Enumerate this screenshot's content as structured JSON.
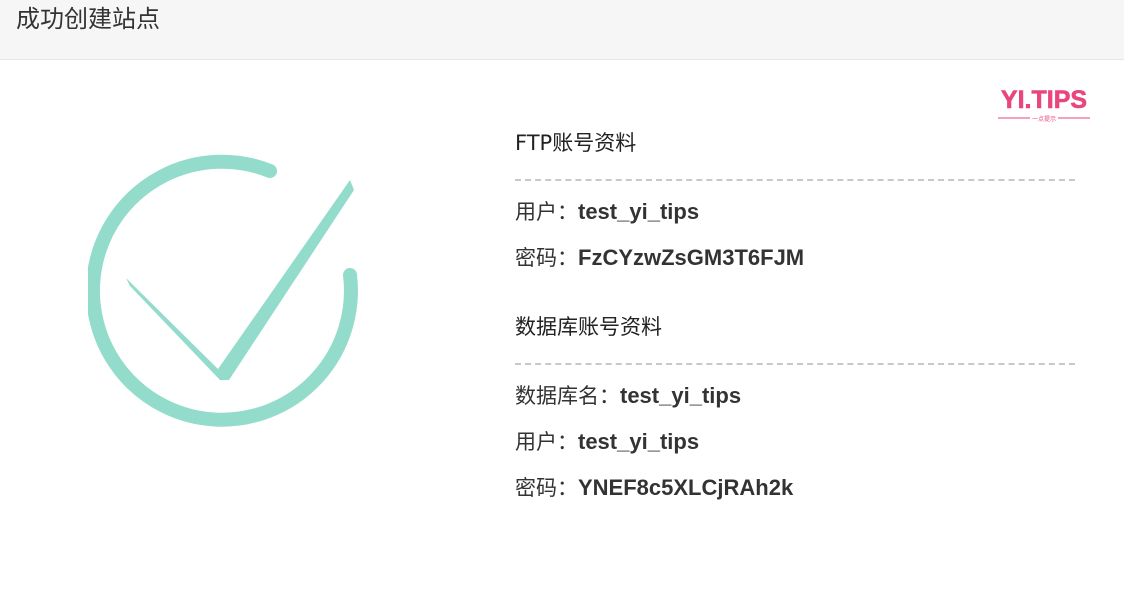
{
  "dialog": {
    "title": "成功创建站点"
  },
  "watermark": {
    "text": "YI.TIPS",
    "subtext": "一点提示",
    "color": "#e8467c"
  },
  "status": {
    "icon": "success-check-icon",
    "color": "#93dccb"
  },
  "ftp": {
    "heading": "FTP账号资料",
    "fields": [
      {
        "label": "用户：",
        "value": "test_yi_tips"
      },
      {
        "label": "密码：",
        "value": "FzCYzwZsGM3T6FJM"
      }
    ]
  },
  "database": {
    "heading": "数据库账号资料",
    "fields": [
      {
        "label": "数据库名：",
        "value": "test_yi_tips"
      },
      {
        "label": "用户：",
        "value": "test_yi_tips"
      },
      {
        "label": "密码：",
        "value": "YNEF8c5XLCjRAh2k"
      }
    ]
  }
}
